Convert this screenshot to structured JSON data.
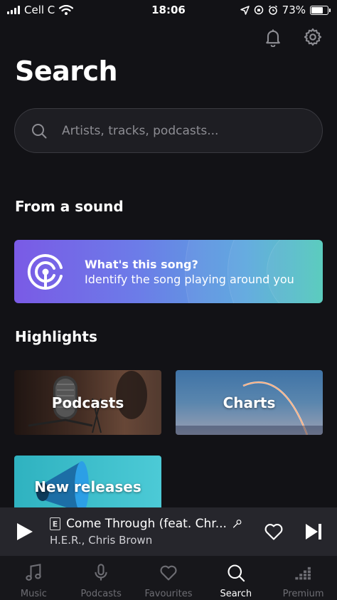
{
  "status_bar": {
    "carrier": "Cell C",
    "time": "18:06",
    "battery": "73%",
    "battery_level": 0.73
  },
  "page": {
    "title": "Search"
  },
  "search": {
    "placeholder": "Artists, tracks, podcasts..."
  },
  "sections": {
    "from_a_sound": "From a sound",
    "highlights": "Highlights"
  },
  "identify_card": {
    "title": "What's this song?",
    "subtitle": "Identify the song playing around you"
  },
  "highlights": [
    {
      "label": "Podcasts"
    },
    {
      "label": "Charts"
    },
    {
      "label": "New releases"
    }
  ],
  "player": {
    "explicit_badge": "E",
    "track_title": "Come Through (feat. Chr...",
    "artist": "H.E.R., Chris Brown"
  },
  "tabs": [
    {
      "label": "Music",
      "icon": "music-note-icon",
      "active": false
    },
    {
      "label": "Podcasts",
      "icon": "microphone-icon",
      "active": false
    },
    {
      "label": "Favourites",
      "icon": "heart-icon",
      "active": false
    },
    {
      "label": "Search",
      "icon": "search-icon",
      "active": true
    },
    {
      "label": "Premium",
      "icon": "equalizer-icon",
      "active": false
    }
  ],
  "colors": {
    "background": "#121216",
    "card_gradient_start": "#7a5ae6",
    "card_gradient_end": "#48c6b8",
    "player_background": "#26262c"
  }
}
